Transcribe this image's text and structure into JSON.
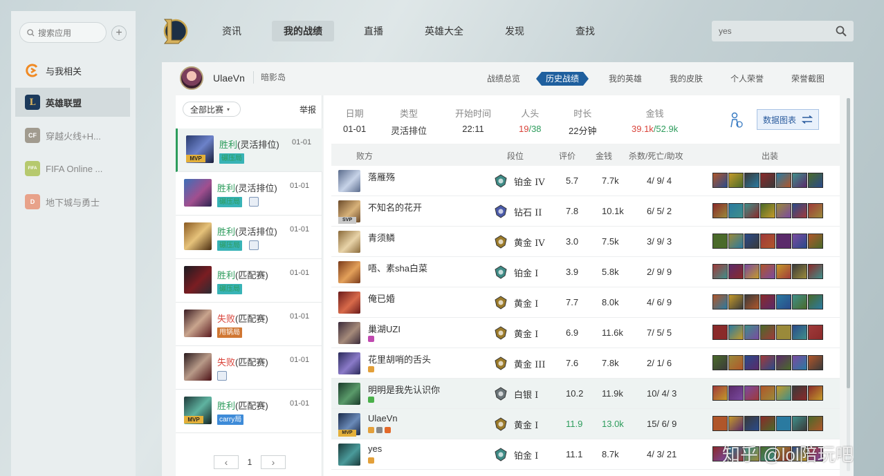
{
  "sidebar": {
    "search_placeholder": "搜索应用",
    "add_label": "+",
    "items": [
      {
        "label": "与我相关",
        "icon": "related-icon",
        "color": "#f08a24"
      },
      {
        "label": "英雄联盟",
        "icon": "lol-icon",
        "color": "#1c3a5c"
      },
      {
        "label": "穿越火线+H...",
        "icon": "cf-icon",
        "color": "#a19b8f"
      },
      {
        "label": "FIFA Online ...",
        "icon": "fifa-icon",
        "color": "#b6c96e"
      },
      {
        "label": "地下城与勇士",
        "icon": "dnf-icon",
        "color": "#e8a28a"
      }
    ]
  },
  "nav": {
    "items": [
      "资讯",
      "我的战绩",
      "直播",
      "英雄大全",
      "发现",
      "查找"
    ],
    "active": "我的战绩",
    "search_value": "yes"
  },
  "header": {
    "username": "UlaeVn",
    "server": "暗影岛",
    "tabs": [
      "战绩总览",
      "历史战绩",
      "我的英雄",
      "我的皮肤",
      "个人荣誉",
      "荣誉截图"
    ],
    "active_tab": "历史战绩"
  },
  "list": {
    "filter_label": "全部比赛",
    "report_label": "举报",
    "matches": [
      {
        "result": "胜利",
        "mode": "(灵活排位)",
        "date": "01-01",
        "tag": "碾压局",
        "tag_color": "green",
        "mvp": "MVP",
        "image": false
      },
      {
        "result": "胜利",
        "mode": "(灵活排位)",
        "date": "01-01",
        "tag": "碾压局",
        "tag_color": "green",
        "mvp": "",
        "image": true
      },
      {
        "result": "胜利",
        "mode": "(灵活排位)",
        "date": "01-01",
        "tag": "碾压局",
        "tag_color": "green",
        "mvp": "",
        "image": true
      },
      {
        "result": "胜利",
        "mode": "(匹配赛)",
        "date": "01-01",
        "tag": "碾压局",
        "tag_color": "green",
        "mvp": "",
        "image": false
      },
      {
        "result": "失败",
        "mode": "(匹配赛)",
        "date": "01-01",
        "tag": "甩锅局",
        "tag_color": "orange",
        "mvp": "",
        "image": false
      },
      {
        "result": "失败",
        "mode": "(匹配赛)",
        "date": "01-01",
        "tag": "",
        "tag_color": "",
        "mvp": "",
        "image": true
      },
      {
        "result": "胜利",
        "mode": "(匹配赛)",
        "date": "01-01",
        "tag": "carry局",
        "tag_color": "blue",
        "mvp": "MVP",
        "image": false
      }
    ],
    "page": "1"
  },
  "summary": {
    "date_label": "日期",
    "date": "01-01",
    "type_label": "类型",
    "type": "灵活排位",
    "start_label": "开始时间",
    "start": "22:11",
    "kills_label": "人头",
    "kills_self": "19",
    "kills_total": "/38",
    "duration_label": "时长",
    "duration": "22分钟",
    "gold_label": "金钱",
    "gold_self": "39.1k",
    "gold_total": "/52.9k",
    "chart_button": "数据图表"
  },
  "table": {
    "team": "败方",
    "headers": {
      "rank": "段位",
      "score": "评价",
      "gold": "金钱",
      "kda": "杀数/死亡/助攻",
      "items": "出装"
    },
    "rows": [
      {
        "name": "落雁殇",
        "rank": "铂金 IV",
        "tier": "platinum",
        "score": "5.7",
        "gold": "7.7k",
        "kda": "4/ 9/ 4",
        "badge": ""
      },
      {
        "name": "不知名的花开",
        "rank": "钻石 II",
        "tier": "diamond",
        "score": "7.8",
        "gold": "10.1k",
        "kda": "6/ 5/ 2",
        "badge": "SVP"
      },
      {
        "name": "青须鳞",
        "rank": "黄金 IV",
        "tier": "gold",
        "score": "3.0",
        "gold": "7.5k",
        "kda": "3/ 9/ 3",
        "badge": ""
      },
      {
        "name": "唔、素sha白菜",
        "rank": "铂金 I",
        "tier": "platinum",
        "score": "3.9",
        "gold": "5.8k",
        "kda": "2/ 9/ 9",
        "badge": ""
      },
      {
        "name": "俺已婚",
        "rank": "黄金 I",
        "tier": "gold",
        "score": "7.7",
        "gold": "8.0k",
        "kda": "4/ 6/ 9",
        "badge": ""
      },
      {
        "name": "巢湖UZI",
        "rank": "黄金 I",
        "tier": "gold",
        "score": "6.9",
        "gold": "11.6k",
        "kda": "7/ 5/ 5",
        "badge": ""
      },
      {
        "name": "花里胡哨的舌头",
        "rank": "黄金 III",
        "tier": "gold",
        "score": "7.6",
        "gold": "7.8k",
        "kda": "2/ 1/ 6",
        "badge": ""
      },
      {
        "name": "明明是我先认识你",
        "rank": "白银 I",
        "tier": "silver",
        "score": "10.2",
        "gold": "11.9k",
        "kda": "10/ 4/ 3",
        "badge": ""
      },
      {
        "name": "UlaeVn",
        "rank": "黄金 I",
        "tier": "gold",
        "score": "11.9",
        "gold": "13.0k",
        "kda": "15/ 6/ 9",
        "badge": "MVP"
      },
      {
        "name": "yes",
        "rank": "铂金 I",
        "tier": "platinum",
        "score": "11.1",
        "gold": "8.7k",
        "kda": "4/ 3/ 21",
        "badge": ""
      }
    ]
  },
  "watermark": "知乎 @lol陪玩吧",
  "colors": {
    "win": "#2d9c5c",
    "lose": "#d9433a",
    "accent": "#1f5f9e",
    "mvp": "#e3b03a"
  }
}
